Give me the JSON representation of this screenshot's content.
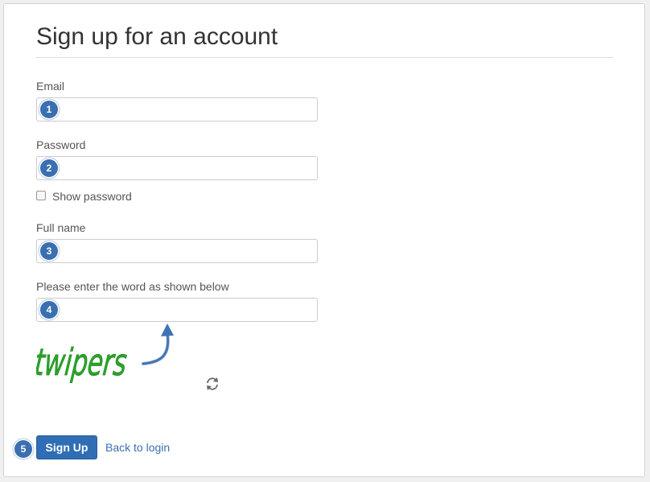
{
  "page": {
    "title": "Sign up for an account"
  },
  "form": {
    "email": {
      "label": "Email",
      "value": "",
      "badge": "1"
    },
    "password": {
      "label": "Password",
      "value": "",
      "badge": "2"
    },
    "show_password": {
      "label": "Show password",
      "checked": false
    },
    "full_name": {
      "label": "Full name",
      "value": "",
      "badge": "3"
    },
    "captcha": {
      "label": "Please enter the word as shown below",
      "value": "",
      "badge": "4",
      "image_word": "twipers"
    }
  },
  "actions": {
    "submit_label": "Sign Up",
    "submit_badge": "5",
    "back_link": "Back to login"
  },
  "colors": {
    "accent": "#2f6eb5",
    "badge": "#3a6fb0",
    "captcha_text": "#2aa52a"
  },
  "icons": {
    "refresh": "refresh-icon",
    "arrow": "curved-arrow-icon"
  }
}
